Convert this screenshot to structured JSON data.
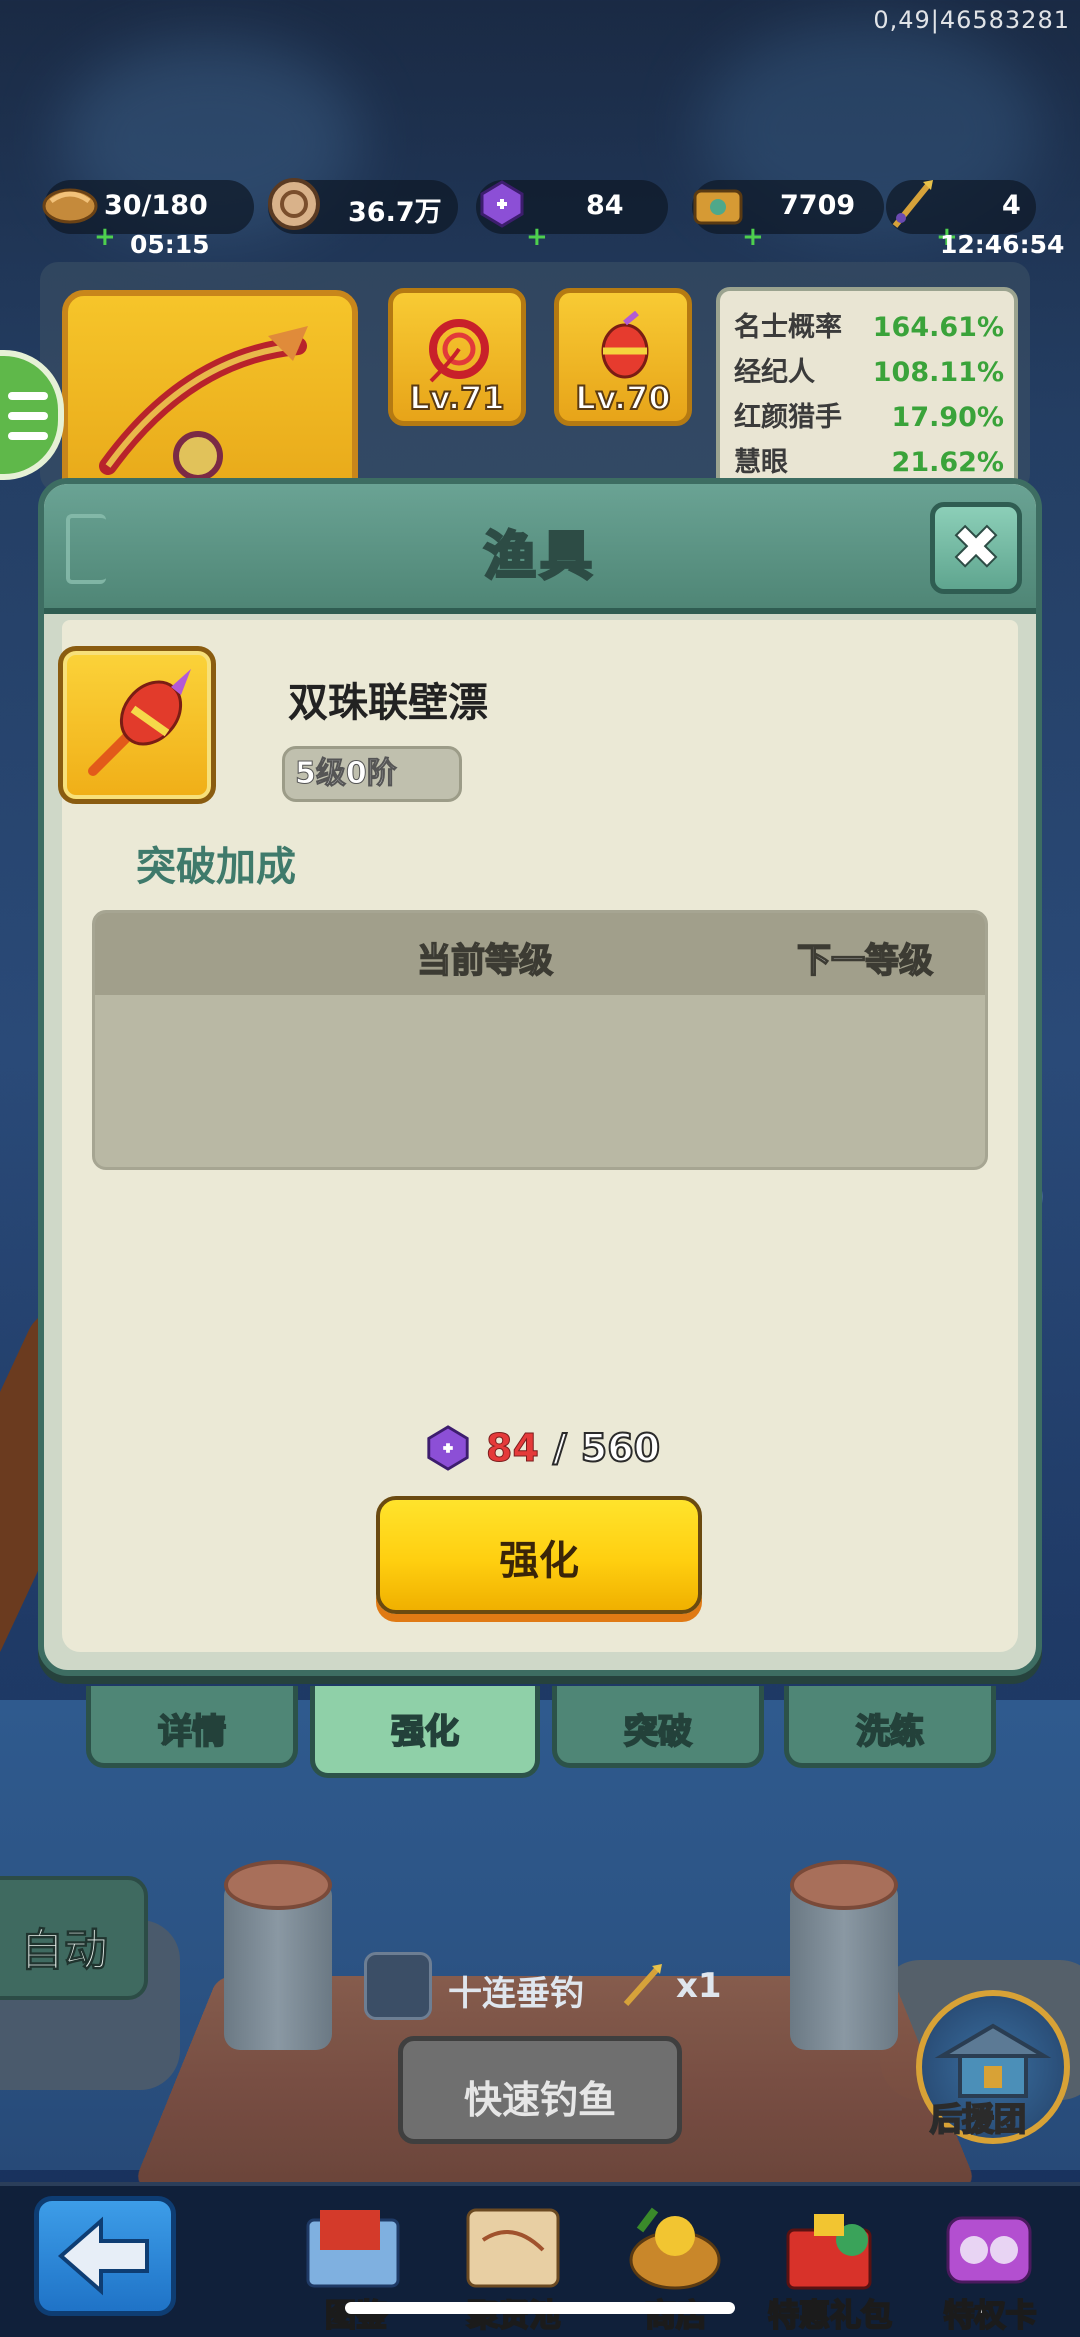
{
  "status_stamp": "0,49|46583281",
  "resources": {
    "stamina": {
      "value": "30/180",
      "timer": "05:15",
      "icon": "bread-icon"
    },
    "coins": {
      "value": "36.7万",
      "icon": "coin-icon"
    },
    "gems": {
      "value": "84",
      "icon": "purple-gem-icon"
    },
    "chest": {
      "value": "7709",
      "icon": "treasure-chest-icon"
    },
    "rods": {
      "value": "4",
      "timer": "12:46:54",
      "icon": "fishing-rod-icon"
    }
  },
  "equipment": {
    "slots": [
      {
        "level": "Lv.71",
        "icon": "red-fishing-line-icon"
      },
      {
        "level": "Lv.70",
        "icon": "bobber-icon"
      }
    ],
    "stats": [
      {
        "name": "名士概率",
        "value": "164.61%"
      },
      {
        "name": "经纪人",
        "value": "108.11%"
      },
      {
        "name": "红颜猎手",
        "value": "17.90%"
      },
      {
        "name": "慧眼",
        "value": "21.62%"
      }
    ]
  },
  "modal": {
    "title": "渔具",
    "close_label": "✖",
    "item_name": "双珠联壁漂",
    "item_grade": "5级0阶",
    "section_title": "突破加成",
    "table_headers": {
      "current": "当前等级",
      "next": "下一等级"
    },
    "cost": {
      "have": "84",
      "separator": "/",
      "need": "560"
    },
    "action_label": "强化"
  },
  "tabs": [
    {
      "label": "详情",
      "active": false
    },
    {
      "label": "强化",
      "active": true
    },
    {
      "label": "突破",
      "active": false
    },
    {
      "label": "洗练",
      "active": false
    }
  ],
  "fishing": {
    "auto_label": "自动",
    "ten_cast_label": "十连垂钓",
    "ten_cast_count": "x1",
    "quick_fish_label": "快速钓鱼",
    "support_label": "后援团"
  },
  "bottom_nav": [
    {
      "label": "图鉴",
      "icon": "book-icon"
    },
    {
      "label": "聚贤池",
      "icon": "map-scroll-icon"
    },
    {
      "label": "商店",
      "icon": "shop-basket-icon"
    },
    {
      "label": "特惠礼包",
      "icon": "gift-pack-icon"
    },
    {
      "label": "特权卡",
      "icon": "privilege-card-icon"
    }
  ],
  "colors": {
    "accent_green": "#4f8676",
    "button_yellow": "#ffcf10",
    "stat_green": "#3aa33a",
    "insufficient_red": "#e53a3a"
  }
}
